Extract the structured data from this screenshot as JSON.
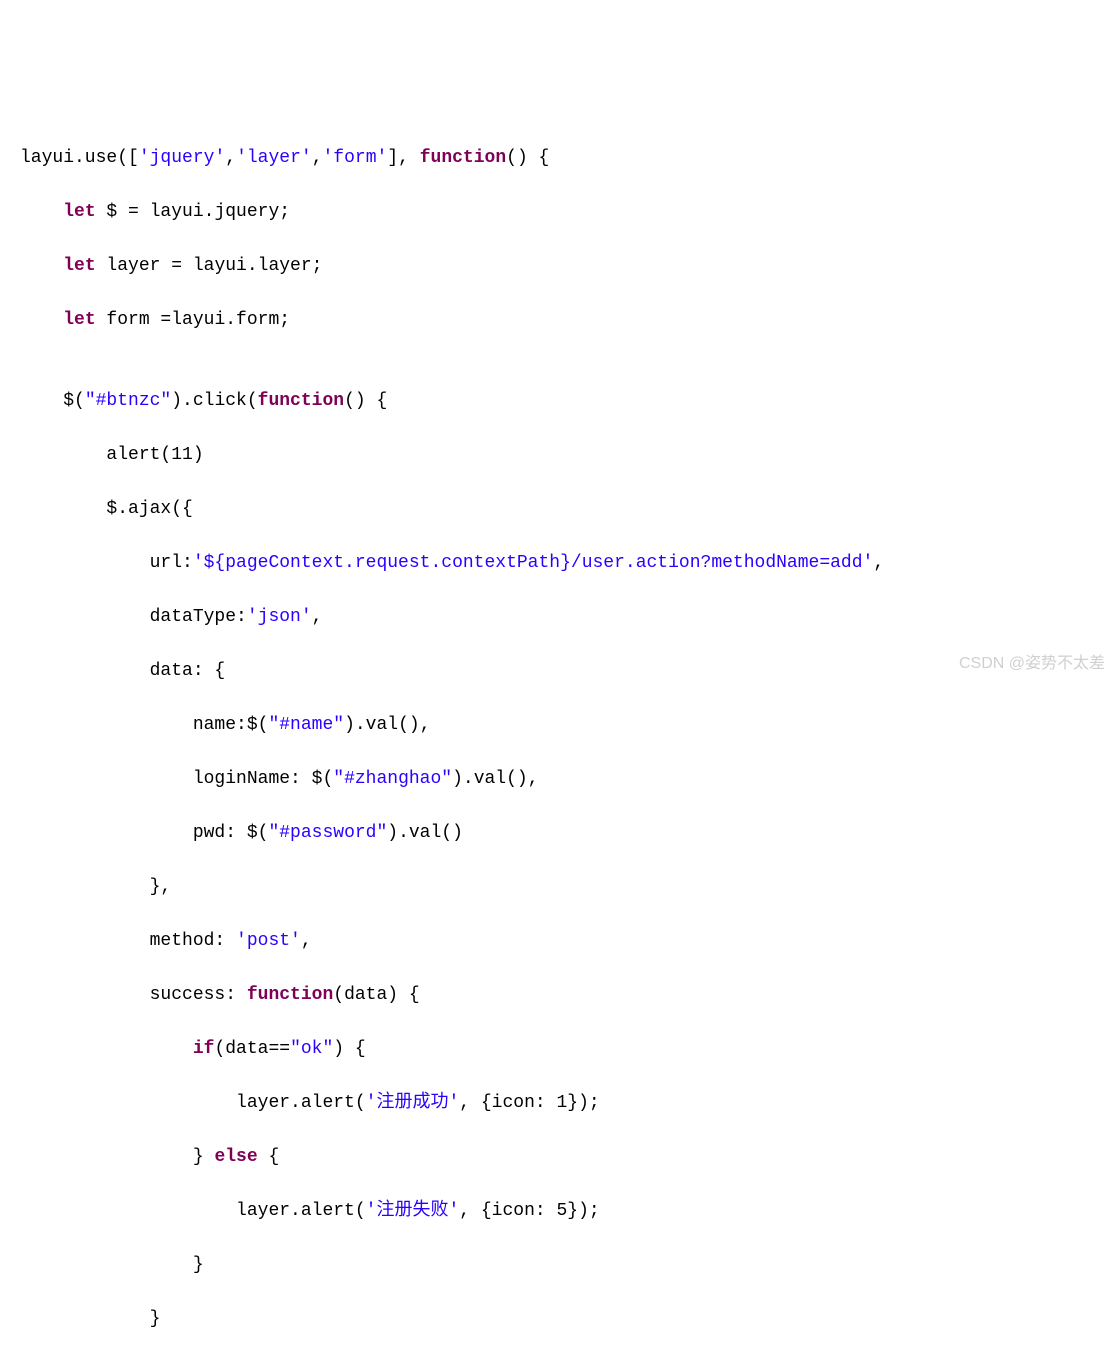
{
  "code": {
    "l1": {
      "a": "layui.use([",
      "b": "'jquery'",
      "c": ",",
      "d": "'layer'",
      "e": ",",
      "f": "'form'",
      "g": "], ",
      "h": "function",
      "i": "() {"
    },
    "l2": {
      "a": "    ",
      "b": "let",
      "c": " $ = layui.jquery;"
    },
    "l3": {
      "a": "    ",
      "b": "let",
      "c": " layer = layui.layer;"
    },
    "l4": {
      "a": "    ",
      "b": "let",
      "c": " form =layui.form;"
    },
    "l5": "",
    "l6": {
      "a": "    $(",
      "b": "\"#btnzc\"",
      "c": ").click(",
      "d": "function",
      "e": "() {"
    },
    "l7": "        alert(11)",
    "l8": "        $.ajax({",
    "l9": {
      "a": "            url:",
      "b": "'${pageContext.request.contextPath}/user.action?methodName=add'",
      "c": ","
    },
    "l10": {
      "a": "            dataType:",
      "b": "'json'",
      "c": ","
    },
    "l11": "            data: {",
    "l12": {
      "a": "                name:$(",
      "b": "\"#name\"",
      "c": ").val(),"
    },
    "l13": {
      "a": "                loginName: $(",
      "b": "\"#zhanghao\"",
      "c": ").val(),"
    },
    "l14": {
      "a": "                pwd: $(",
      "b": "\"#password\"",
      "c": ").val()"
    },
    "l15": "            },",
    "l16": {
      "a": "            method: ",
      "b": "'post'",
      "c": ","
    },
    "l17": {
      "a": "            success: ",
      "b": "function",
      "c": "(data) {"
    },
    "l18": {
      "a": "                ",
      "b": "if",
      "c": "(data==",
      "d": "\"ok\"",
      "e": ") {"
    },
    "l19": {
      "a": "                    layer.alert(",
      "b": "'注册成功'",
      "c": ", {icon: 1});"
    },
    "l20": {
      "a": "                } ",
      "b": "else",
      "c": " {"
    },
    "l21": {
      "a": "                    layer.alert(",
      "b": "'注册失败'",
      "c": ", {icon: 5});"
    },
    "l22": "                }",
    "l23": "            }"
  },
  "watermark": "CSDN @姿势不太差"
}
